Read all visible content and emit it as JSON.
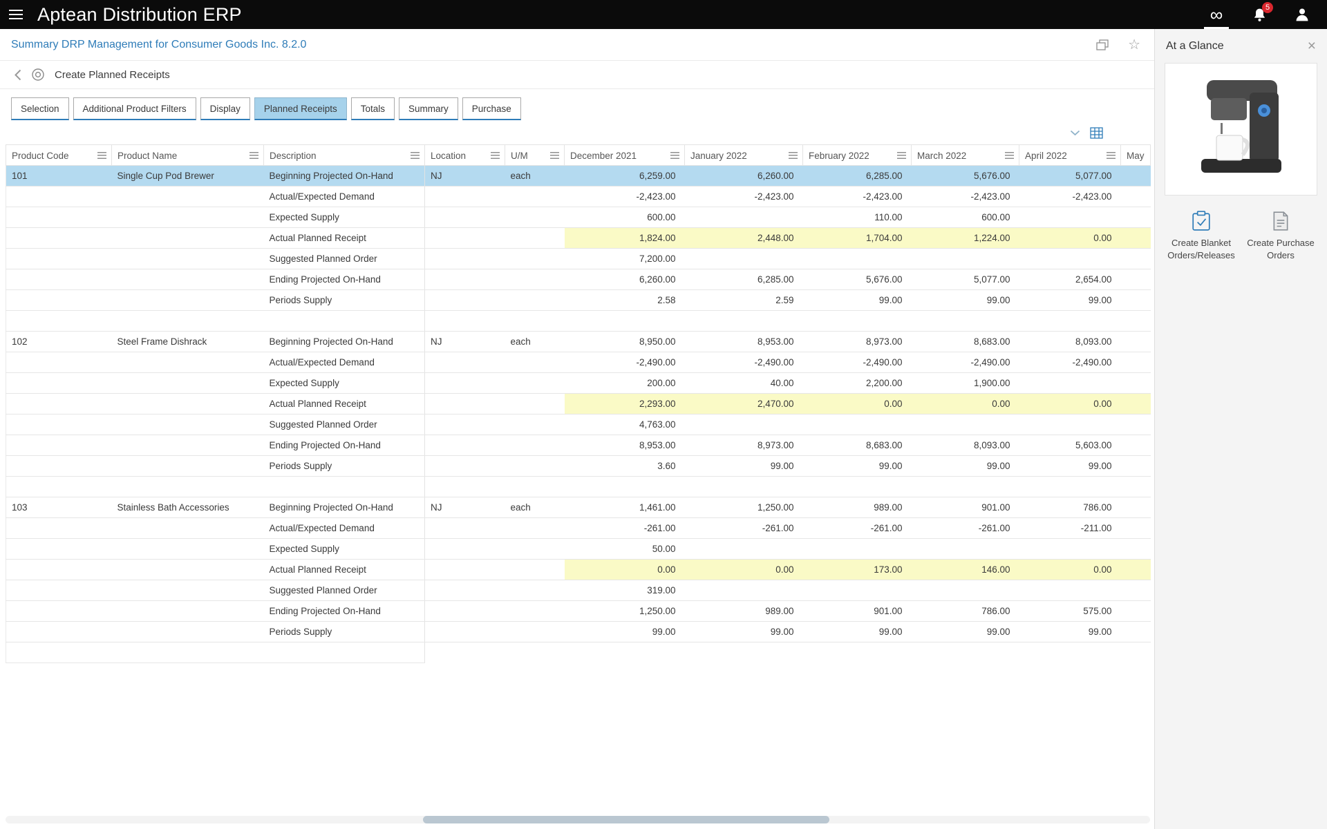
{
  "app": {
    "title": "Aptean Distribution ERP",
    "notification_badge": "5"
  },
  "page": {
    "title": "Summary DRP Management for Consumer Goods Inc. 8.2.0",
    "breadcrumb": "Create Planned Receipts"
  },
  "tabs": [
    {
      "label": "Selection",
      "active": false
    },
    {
      "label": "Additional Product Filters",
      "active": false
    },
    {
      "label": "Display",
      "active": false
    },
    {
      "label": "Planned Receipts",
      "active": true
    },
    {
      "label": "Totals",
      "active": false
    },
    {
      "label": "Summary",
      "active": false
    },
    {
      "label": "Purchase",
      "active": false
    }
  ],
  "grid": {
    "columns": [
      "Product Code",
      "Product Name",
      "Description",
      "Location",
      "U/M",
      "December 2021",
      "January 2022",
      "February 2022",
      "March 2022",
      "April 2022",
      "May"
    ],
    "products": [
      {
        "code": "101",
        "name": "Single Cup Pod Brewer",
        "location": "NJ",
        "uom": "each",
        "selected_first_row": true,
        "rows": [
          {
            "label": "Beginning Projected On-Hand",
            "values": [
              "6,259.00",
              "6,260.00",
              "6,285.00",
              "5,676.00",
              "5,077.00"
            ]
          },
          {
            "label": "Actual/Expected Demand",
            "values": [
              "-2,423.00",
              "-2,423.00",
              "-2,423.00",
              "-2,423.00",
              "-2,423.00"
            ]
          },
          {
            "label": "Expected Supply",
            "values": [
              "600.00",
              "",
              "110.00",
              "600.00",
              ""
            ]
          },
          {
            "label": "Actual Planned Receipt",
            "values": [
              "1,824.00",
              "2,448.00",
              "1,704.00",
              "1,224.00",
              "0.00"
            ],
            "highlight": "yellow"
          },
          {
            "label": "Suggested Planned Order",
            "values": [
              "7,200.00",
              "",
              "",
              "",
              ""
            ]
          },
          {
            "label": "Ending Projected On-Hand",
            "values": [
              "6,260.00",
              "6,285.00",
              "5,676.00",
              "5,077.00",
              "2,654.00"
            ]
          },
          {
            "label": "Periods Supply",
            "values": [
              "2.58",
              "2.59",
              "99.00",
              "99.00",
              "99.00"
            ]
          }
        ]
      },
      {
        "code": "102",
        "name": "Steel Frame Dishrack",
        "location": "NJ",
        "uom": "each",
        "rows": [
          {
            "label": "Beginning Projected On-Hand",
            "values": [
              "8,950.00",
              "8,953.00",
              "8,973.00",
              "8,683.00",
              "8,093.00"
            ]
          },
          {
            "label": "Actual/Expected Demand",
            "values": [
              "-2,490.00",
              "-2,490.00",
              "-2,490.00",
              "-2,490.00",
              "-2,490.00"
            ]
          },
          {
            "label": "Expected Supply",
            "values": [
              "200.00",
              "40.00",
              "2,200.00",
              "1,900.00",
              ""
            ]
          },
          {
            "label": "Actual Planned Receipt",
            "values": [
              "2,293.00",
              "2,470.00",
              "0.00",
              "0.00",
              "0.00"
            ],
            "highlight": "yellow"
          },
          {
            "label": "Suggested Planned Order",
            "values": [
              "4,763.00",
              "",
              "",
              "",
              ""
            ]
          },
          {
            "label": "Ending Projected On-Hand",
            "values": [
              "8,953.00",
              "8,973.00",
              "8,683.00",
              "8,093.00",
              "5,603.00"
            ]
          },
          {
            "label": "Periods Supply",
            "values": [
              "3.60",
              "99.00",
              "99.00",
              "99.00",
              "99.00"
            ]
          }
        ]
      },
      {
        "code": "103",
        "name": "Stainless Bath Accessories",
        "location": "NJ",
        "uom": "each",
        "rows": [
          {
            "label": "Beginning Projected On-Hand",
            "values": [
              "1,461.00",
              "1,250.00",
              "989.00",
              "901.00",
              "786.00"
            ]
          },
          {
            "label": "Actual/Expected Demand",
            "values": [
              "-261.00",
              "-261.00",
              "-261.00",
              "-261.00",
              "-211.00"
            ]
          },
          {
            "label": "Expected Supply",
            "values": [
              "50.00",
              "",
              "",
              "",
              ""
            ]
          },
          {
            "label": "Actual Planned Receipt",
            "values": [
              "0.00",
              "0.00",
              "173.00",
              "146.00",
              "0.00"
            ],
            "highlight": "yellow"
          },
          {
            "label": "Suggested Planned Order",
            "values": [
              "319.00",
              "",
              "",
              "",
              ""
            ]
          },
          {
            "label": "Ending Projected On-Hand",
            "values": [
              "1,250.00",
              "989.00",
              "901.00",
              "786.00",
              "575.00"
            ]
          },
          {
            "label": "Periods Supply",
            "values": [
              "99.00",
              "99.00",
              "99.00",
              "99.00",
              "99.00"
            ]
          }
        ]
      }
    ]
  },
  "panel": {
    "title": "At a Glance",
    "actions": [
      {
        "label": "Create Blanket Orders/Releases",
        "icon": "clipboard-check-icon"
      },
      {
        "label": "Create Purchase Orders",
        "icon": "purchase-document-icon"
      }
    ]
  },
  "icons": [
    "menu-icon",
    "infinity-icon",
    "bell-icon",
    "user-icon",
    "popout-icon",
    "favorite-star-icon",
    "back-icon",
    "page-circle-icon",
    "chevron-down-icon",
    "grid-columns-icon",
    "column-menu-icon",
    "close-icon",
    "clipboard-check-icon",
    "purchase-document-icon"
  ],
  "colors": {
    "accent_blue": "#2e7cb8",
    "selected_row": "#b4daf0",
    "highlight_yellow": "#fafac6",
    "active_tab": "#a6d2eb",
    "badge_red": "#d9272e",
    "topbar": "#0b0b0b"
  }
}
